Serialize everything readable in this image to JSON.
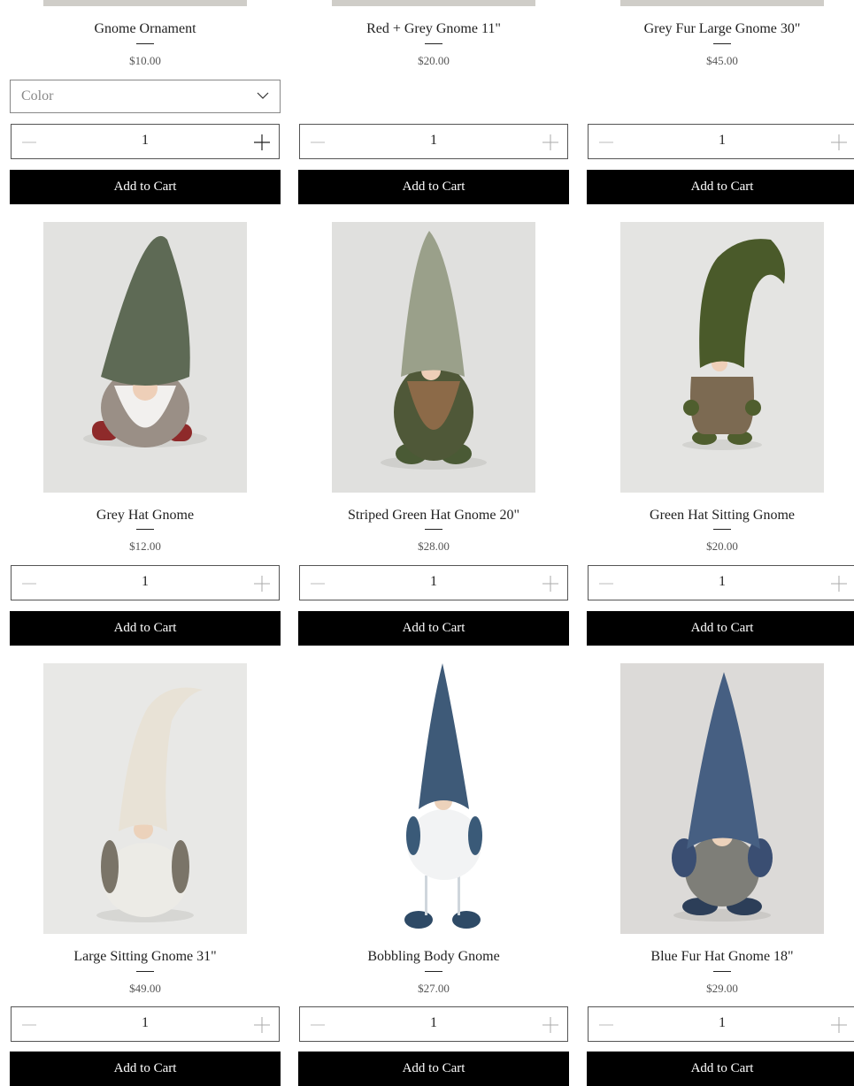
{
  "products": [
    {
      "name": "Gnome Ornament",
      "price": "$10.00",
      "quantity": "1",
      "add_label": "Add to Cart",
      "color_placeholder": "Color"
    },
    {
      "name": "Red + Grey Gnome 11\"",
      "price": "$20.00",
      "quantity": "1",
      "add_label": "Add to Cart"
    },
    {
      "name": "Grey Fur Large Gnome 30\"",
      "price": "$45.00",
      "quantity": "1",
      "add_label": "Add to Cart"
    },
    {
      "name": "Grey Hat Gnome",
      "price": "$12.00",
      "quantity": "1",
      "add_label": "Add to Cart"
    },
    {
      "name": "Striped Green Hat Gnome 20\"",
      "price": "$28.00",
      "quantity": "1",
      "add_label": "Add to Cart"
    },
    {
      "name": "Green Hat Sitting Gnome",
      "price": "$20.00",
      "quantity": "1",
      "add_label": "Add to Cart"
    },
    {
      "name": "Large Sitting Gnome 31\"",
      "price": "$49.00",
      "quantity": "1",
      "add_label": "Add to Cart"
    },
    {
      "name": "Bobbling Body Gnome",
      "price": "$27.00",
      "quantity": "1",
      "add_label": "Add to Cart"
    },
    {
      "name": "Blue Fur Hat Gnome 18\"",
      "price": "$29.00",
      "quantity": "1",
      "add_label": "Add to Cart"
    }
  ],
  "icons": {
    "decrement": "minus-icon",
    "increment": "plus-icon",
    "dropdown": "chevron-down-icon"
  },
  "colors": {
    "button_bg": "#000000",
    "button_text": "#ffffff",
    "image_bg": "#e4e4e2",
    "green_hat": "#4a5a35",
    "blue_hat": "#3e5a78",
    "grey_hat": "#5e6a55",
    "cream_hat": "#e8e2d6"
  }
}
